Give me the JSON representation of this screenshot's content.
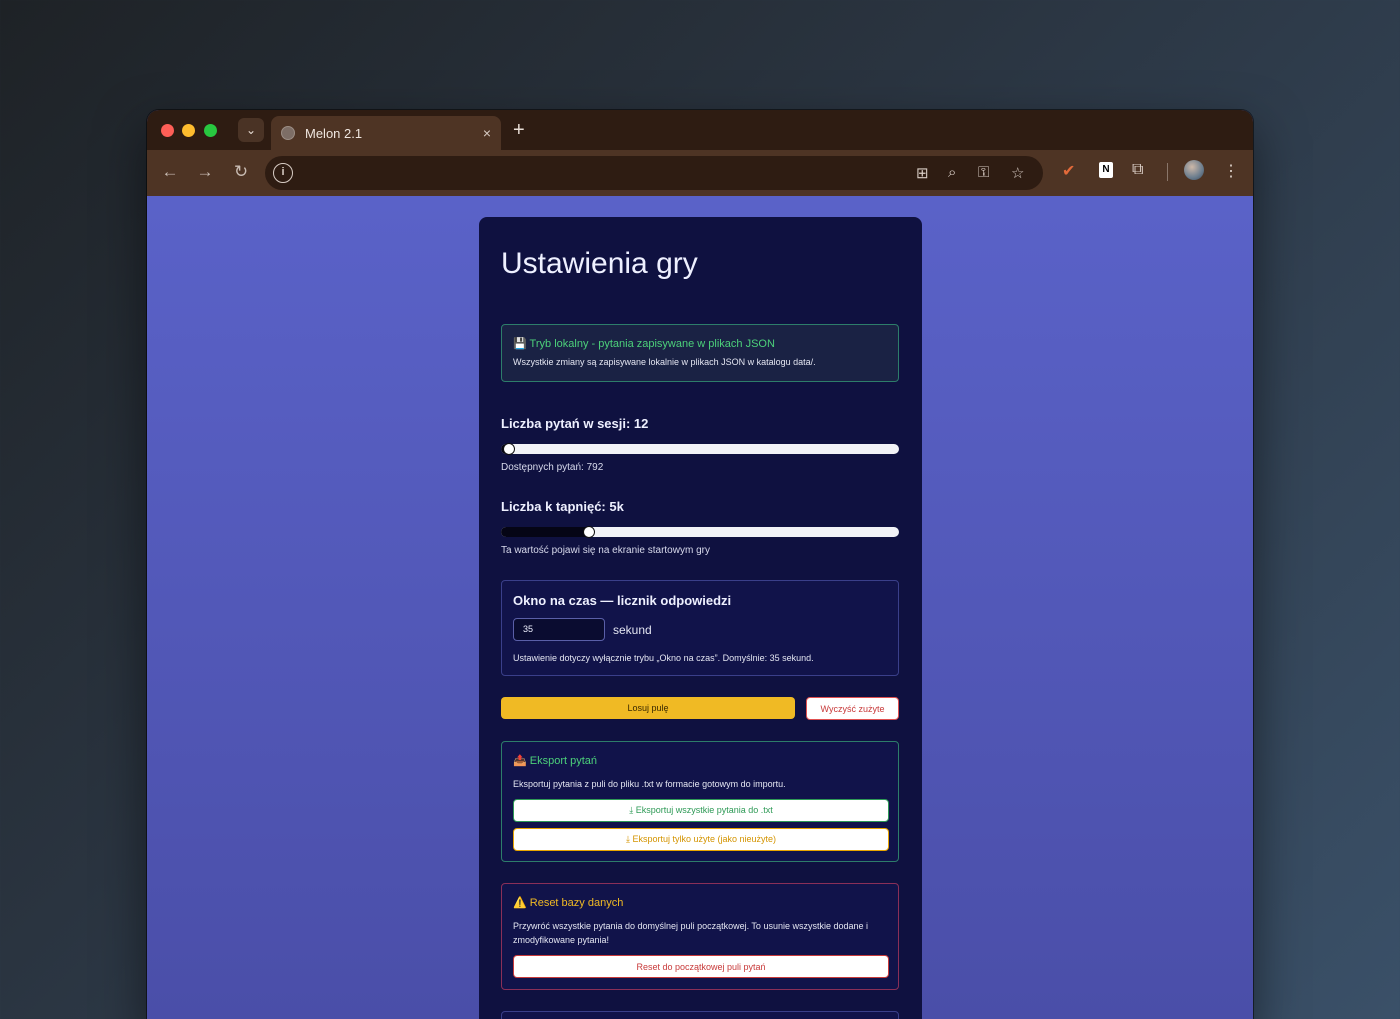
{
  "browser": {
    "tab_title": "Melon 2.1",
    "tab_close": "×",
    "new_tab": "+",
    "icons": [
      "back-icon",
      "forward-icon",
      "reload-icon",
      "site-info-icon",
      "translate-icon",
      "zoom-icon",
      "password-key-icon",
      "bookmark-star-icon",
      "extension-color-icon",
      "extension-n-icon",
      "extensions-puzzle-icon",
      "profile-avatar",
      "menu-kebab-icon"
    ],
    "extension_letter": "N"
  },
  "page": {
    "title": "Ustawienia gry",
    "info": {
      "title": "💾 Tryb lokalny - pytania zapisywane w plikach JSON",
      "text": "Wszystkie zmiany są zapisywane lokalnie w plikach JSON w katalogu data/."
    },
    "questions": {
      "label": "Liczba pytań w sesji: 12",
      "value": 12,
      "fraction": 0.02,
      "available": "Dostępnych pytań: 792"
    },
    "taps": {
      "label": "Liczba k tapnięć: 5k",
      "fraction": 0.22,
      "note": "Ta wartość pojawi się na ekranie startowym gry"
    },
    "timer": {
      "title": "Okno na czas — licznik odpowiedzi",
      "value": "35",
      "unit": "sekund",
      "note": "Ustawienie dotyczy wyłącznie trybu „Okno na czas”. Domyślnie: 35 sekund."
    },
    "buttons": {
      "random": "Losuj pulę",
      "clear": "Wyczyść zużyte"
    },
    "export": {
      "title": "📤 Eksport pytań",
      "text": "Eksportuj pytania z puli do pliku .txt w formacie gotowym do importu.",
      "btn_all": "⤓  Eksportuj wszystkie pytania do .txt",
      "btn_used": "⤓  Eksportuj tylko użyte (jako nieużyte)"
    },
    "reset": {
      "title": "⚠️ Reset bazy danych",
      "text": "Przywróć wszystkie pytania do domyślnej puli początkowej. To usunie wszystkie dodane i zmodyfikowane pytania!",
      "btn": "Reset do początkowej puli pytań"
    }
  },
  "colors": {
    "page_bg": "#5a62c8",
    "card_bg": "#0f1140",
    "accent_green": "#4cd07a",
    "accent_yellow": "#f0ba24",
    "danger": "#c83a3a"
  }
}
